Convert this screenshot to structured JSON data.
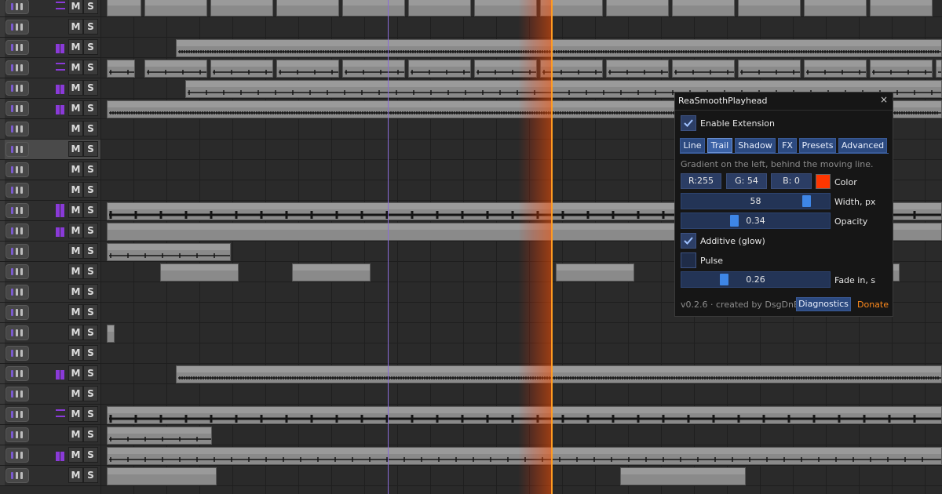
{
  "tracks": {
    "mute_label": "M",
    "solo_label": "S",
    "count": 24,
    "selected_index": 7
  },
  "colors": {
    "playhead": "#ff9a20",
    "trail": "#ff3600",
    "edit_cursor": "#8a6bd8",
    "accent": "#3b62a6",
    "meter": "#8a3ad8",
    "donate": "#ff8a1c"
  },
  "panel": {
    "title": "ReaSmoothPlayhead",
    "close_icon": "×",
    "enable_label": "Enable Extension",
    "enable_checked": true,
    "tabs": [
      "Line",
      "Trail",
      "Shadow",
      "FX",
      "Presets",
      "Advanced"
    ],
    "active_tab": "Trail",
    "hint": "Gradient on the left, behind the moving line.",
    "color": {
      "r_label": "R:255",
      "g_label": "G: 54",
      "b_label": "B:  0",
      "label": "Color",
      "swatch": "#ff3600"
    },
    "width": {
      "value": "58",
      "label": "Width, px",
      "fraction": 0.87
    },
    "opacity": {
      "value": "0.34",
      "label": "Opacity",
      "fraction": 0.34
    },
    "additive": {
      "label": "Additive (glow)",
      "checked": true
    },
    "pulse": {
      "label": "Pulse",
      "checked": false
    },
    "fade_in": {
      "value": "0.26",
      "label": "Fade in, s",
      "fraction": 0.26
    },
    "footer": "v0.2.6 · created by DsgDnB",
    "diagnostics_label": "Diagnostics",
    "donate_label": "Donate"
  }
}
